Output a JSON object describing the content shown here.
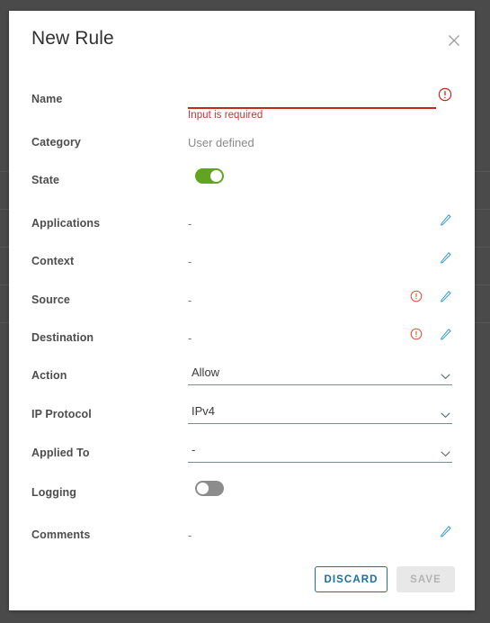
{
  "backdrop": {
    "color": "#4a4a4a",
    "row_line_color": "#565656",
    "row_line_y": [
      190,
      232,
      274,
      316,
      358
    ]
  },
  "dialog": {
    "title": "New Rule",
    "close_icon": "close-icon",
    "accent_color": "#1a7198",
    "error_color": "#c02b1c",
    "toggle_on_color": "#62a420",
    "toggle_off_color": "#8c8c8c"
  },
  "fields": {
    "name": {
      "label": "Name",
      "value": "",
      "placeholder": "",
      "error": "Input is required",
      "error_icon": "error-exclamation-icon"
    },
    "category": {
      "label": "Category",
      "value": "User defined"
    },
    "state": {
      "label": "State",
      "value": "on"
    },
    "applications": {
      "label": "Applications",
      "value": "-",
      "edit_icon": "pencil-edit-icon"
    },
    "context": {
      "label": "Context",
      "value": "-",
      "edit_icon": "pencil-edit-icon"
    },
    "source": {
      "label": "Source",
      "value": "-",
      "warning_icon": "error-exclamation-icon",
      "edit_icon": "pencil-edit-icon"
    },
    "destination": {
      "label": "Destination",
      "value": "-",
      "warning_icon": "error-exclamation-icon",
      "edit_icon": "pencil-edit-icon"
    },
    "action": {
      "label": "Action",
      "value": "Allow",
      "caret_icon": "chevron-down-icon"
    },
    "ip_protocol": {
      "label": "IP Protocol",
      "value": "IPv4",
      "caret_icon": "chevron-down-icon"
    },
    "applied_to": {
      "label": "Applied To",
      "value": "-",
      "caret_icon": "chevron-down-icon"
    },
    "logging": {
      "label": "Logging",
      "value": "off"
    },
    "comments": {
      "label": "Comments",
      "value": "-",
      "edit_icon": "pencil-edit-icon"
    }
  },
  "footer": {
    "discard_label": "DISCARD",
    "save_label": "SAVE",
    "save_disabled": true
  }
}
